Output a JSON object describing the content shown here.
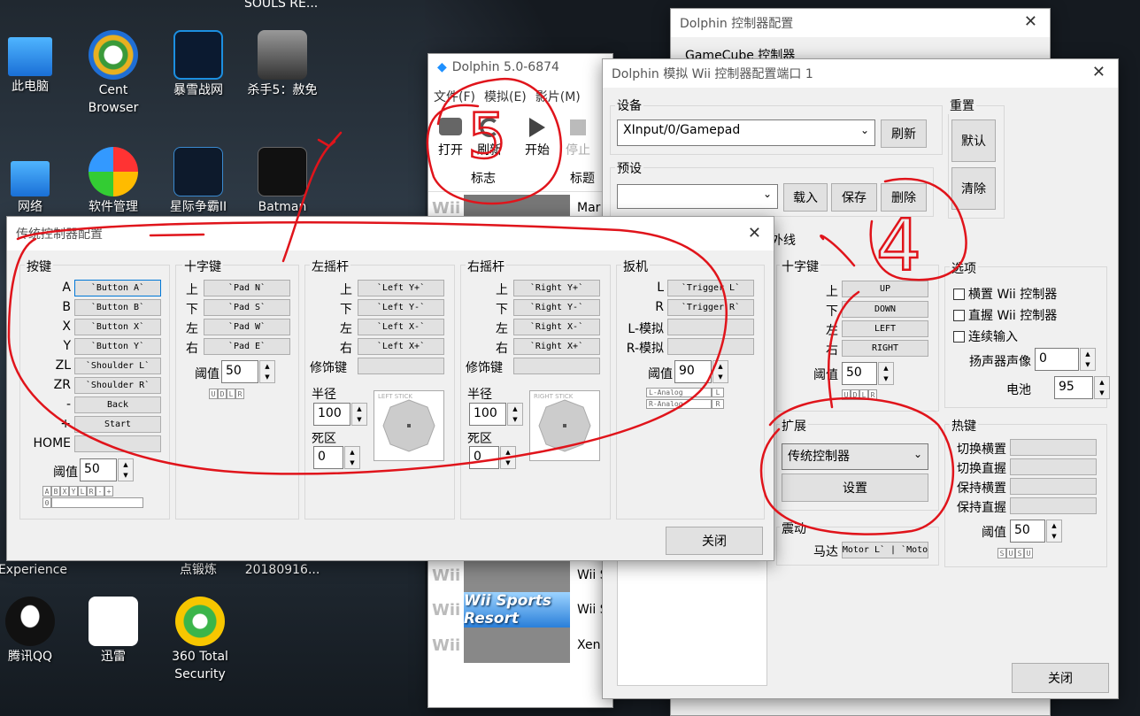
{
  "desktop": {
    "top_caption": "SOULS RE...",
    "icons": [
      "此电脑",
      "Cent Browser",
      "暴雪战网",
      "杀手5：赦免",
      "网络",
      "软件管理",
      "星际争霸II",
      "Batman",
      "Experience",
      "点锻炼",
      "20180916...",
      "腾讯QQ",
      "迅雷",
      "360 Total Security"
    ]
  },
  "gc_window": {
    "title": "Dolphin 控制器配置",
    "subtitle": "GameCube 控制器"
  },
  "dolphin_main": {
    "title": "Dolphin 5.0-6874",
    "menu": [
      "文件(F)",
      "模拟(E)",
      "影片(M)"
    ],
    "toolbar": [
      "打开",
      "刷新",
      "开始",
      "停止"
    ],
    "columns": [
      "标志",
      "标题"
    ],
    "rows": [
      {
        "platform": "Wii",
        "title": "Mar"
      },
      {
        "platform": "Wii",
        "title": "Wii S"
      },
      {
        "platform": "Wii",
        "banner": "Wii Sports Resort",
        "title": "Wii S"
      },
      {
        "platform": "Wii",
        "title": "Xen"
      }
    ]
  },
  "wii_window": {
    "title": "Dolphin 模拟 Wii 控制器配置端口 1",
    "device": {
      "label": "设备",
      "value": "XInput/0/Gamepad",
      "refresh": "刷新"
    },
    "reset": {
      "label": "重置",
      "default": "默认",
      "clear": "清除"
    },
    "preset": {
      "label": "预设",
      "value": "",
      "load": "载入",
      "save": "保存",
      "delete": "删除"
    },
    "tab": "外线",
    "dpad": {
      "label": "十字键",
      "dirs": [
        "上",
        "下",
        "左",
        "右"
      ],
      "keys": [
        "UP",
        "DOWN",
        "LEFT",
        "RIGHT"
      ],
      "threshold_label": "阈值",
      "threshold": "50",
      "bits": [
        "U",
        "D",
        "L",
        "R"
      ]
    },
    "options": {
      "label": "选项",
      "sideways": "横置 Wii 控制器",
      "upright": "直握 Wii 控制器",
      "continuous": "连续输入",
      "speaker_label": "扬声器声像",
      "speaker": "0",
      "battery_label": "电池",
      "battery": "95"
    },
    "extension": {
      "label": "扩展",
      "value": "传统控制器",
      "setup": "设置"
    },
    "rumble": {
      "label": "震动",
      "motor_label": "马达",
      "motor": "`Motor L` | `Motor"
    },
    "hotkeys": {
      "label": "热键",
      "items": [
        "切换横置",
        "切换直握",
        "保持横置",
        "保持直握"
      ],
      "threshold_label": "阈值",
      "threshold": "50",
      "bits": [
        "S",
        "U",
        "S",
        "U"
      ]
    },
    "close": "关闭"
  },
  "classic": {
    "title": "传统控制器配置",
    "buttons": {
      "label": "按键",
      "names": [
        "A",
        "B",
        "X",
        "Y",
        "ZL",
        "ZR",
        "-",
        "+",
        "HOME"
      ],
      "maps": [
        "`Button A`",
        "`Button B`",
        "`Button X`",
        "`Button Y`",
        "`Shoulder L`",
        "`Shoulder R`",
        "Back",
        "Start",
        ""
      ],
      "threshold_label": "阈值",
      "threshold": "50",
      "bits": [
        "A",
        "B",
        "X",
        "Y",
        "L",
        "R",
        "-",
        "+"
      ],
      "bit2": "0"
    },
    "dpad": {
      "label": "十字键",
      "dirs": [
        "上",
        "下",
        "左",
        "右"
      ],
      "maps": [
        "`Pad N`",
        "`Pad S`",
        "`Pad W`",
        "`Pad E`"
      ],
      "threshold_label": "阈值",
      "threshold": "50",
      "bits": [
        "U",
        "D",
        "L",
        "R"
      ]
    },
    "lstick": {
      "label": "左摇杆",
      "dirs": [
        "上",
        "下",
        "左",
        "右"
      ],
      "maps": [
        "`Left Y+`",
        "`Left Y-`",
        "`Left X-`",
        "`Left X+`"
      ],
      "modifier": "修饰键",
      "radius_label": "半径",
      "radius": "100",
      "dead_label": "死区",
      "dead": "0",
      "caption": "LEFT STICK"
    },
    "rstick": {
      "label": "右摇杆",
      "dirs": [
        "上",
        "下",
        "左",
        "右"
      ],
      "maps": [
        "`Right Y+`",
        "`Right Y-`",
        "`Right X-`",
        "`Right X+`"
      ],
      "modifier": "修饰键",
      "radius_label": "半径",
      "radius": "100",
      "dead_label": "死区",
      "dead": "0",
      "caption": "RIGHT STICK"
    },
    "triggers": {
      "label": "扳机",
      "names": [
        "L",
        "R",
        "L-模拟",
        "R-模拟"
      ],
      "maps": [
        "`Trigger L`",
        "`Trigger R`",
        "",
        ""
      ],
      "threshold_label": "阈值",
      "threshold": "90",
      "analog": [
        "L-Analog",
        "R-Analog"
      ],
      "bits": [
        "L",
        "R"
      ]
    },
    "close": "关闭"
  },
  "annotations": {
    "five": "5",
    "four": "4",
    "color": "#e0141b"
  }
}
